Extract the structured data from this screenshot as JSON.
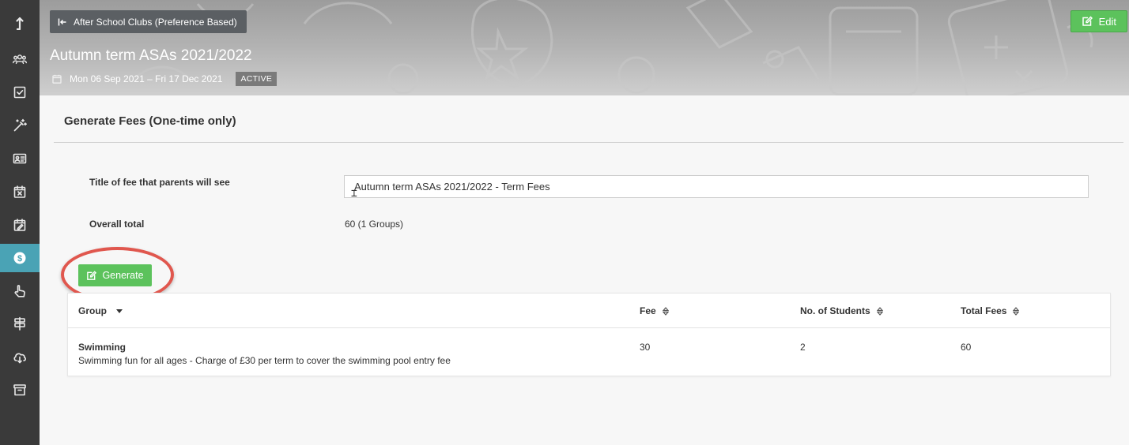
{
  "header": {
    "back_label": "After School Clubs (Preference Based)",
    "edit_label": "Edit",
    "title": "Autumn term ASAs 2021/2022",
    "date_range": "Mon 06 Sep 2021 – Fri 17 Dec 2021",
    "status": "ACTIVE"
  },
  "sidebar": {
    "items": [
      {
        "icon": "upload-arrow-icon"
      },
      {
        "icon": "users-icon"
      },
      {
        "icon": "checkbox-icon"
      },
      {
        "icon": "magic-wand-icon"
      },
      {
        "icon": "id-card-icon"
      },
      {
        "icon": "calendar-x-icon"
      },
      {
        "icon": "calendar-edit-icon"
      },
      {
        "icon": "dollar-icon",
        "active": true
      },
      {
        "icon": "pointer-hand-icon"
      },
      {
        "icon": "signpost-icon"
      },
      {
        "icon": "cloud-download-icon"
      },
      {
        "icon": "archive-icon"
      }
    ]
  },
  "form": {
    "section_title": "Generate Fees (One-time only)",
    "fee_title_label": "Title of fee that parents will see",
    "fee_title_value": "Autumn term ASAs 2021/2022 - Term Fees",
    "overall_total_label": "Overall total",
    "overall_total_value": "60 (1 Groups)",
    "generate_label": "Generate"
  },
  "table": {
    "columns": [
      "Group",
      "Fee",
      "No. of Students",
      "Total Fees"
    ],
    "rows": [
      {
        "group": "Swimming",
        "description": "Swimming fun for all ages - Charge of £30 per term to cover the swimming pool entry fee",
        "fee": "30",
        "students": "2",
        "total": "60"
      }
    ]
  },
  "colors": {
    "sidebar_bg": "#3a3a3a",
    "sidebar_active": "#4aa3b5",
    "primary_green": "#5cc25c",
    "highlight_red": "#e0574e"
  }
}
